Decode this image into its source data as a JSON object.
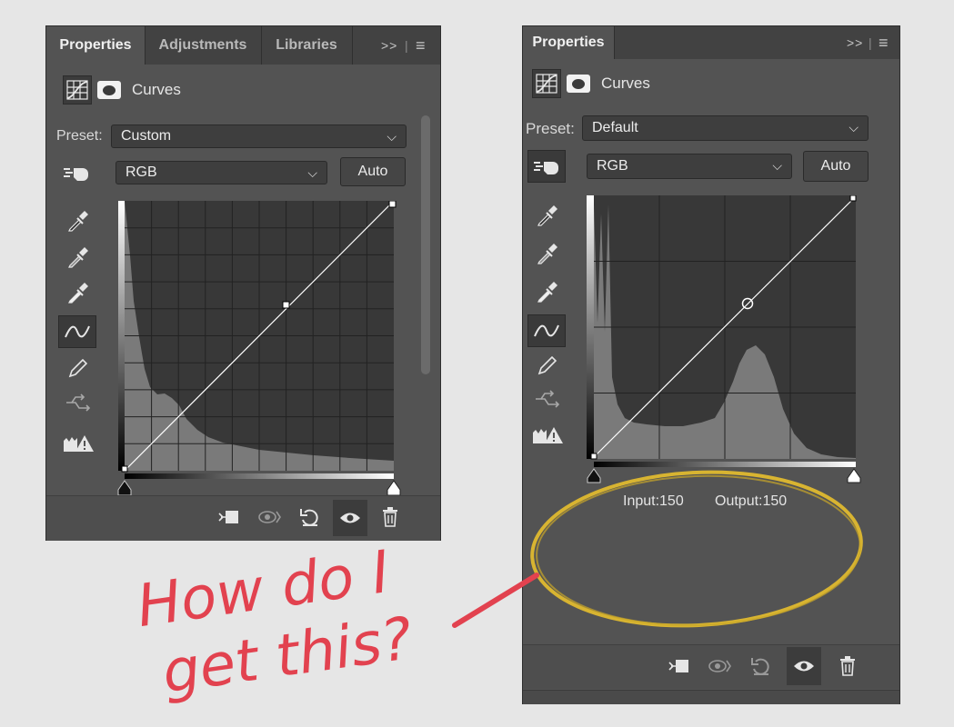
{
  "colors": {
    "panel": "#535353",
    "tabbar": "#424242",
    "accent_circle": "#d8b431",
    "annotation": "#e2424f"
  },
  "left_panel": {
    "tabs": [
      {
        "label": "Properties"
      },
      {
        "label": "Adjustments"
      },
      {
        "label": "Libraries"
      }
    ],
    "menu": {
      "expand": ">>",
      "menu": "≡"
    },
    "header": {
      "title": "Curves",
      "icons": [
        "curves-adjustment-icon",
        "mask-icon"
      ]
    },
    "preset": {
      "label": "Preset:",
      "value": "Custom"
    },
    "channel": {
      "value": "RGB"
    },
    "auto_label": "Auto"
  },
  "right_panel": {
    "tabs": [
      {
        "label": "Properties"
      }
    ],
    "menu": {
      "expand": ">>",
      "menu": "≡"
    },
    "header": {
      "title": "Curves"
    },
    "preset": {
      "label": "Preset:",
      "value": "Default"
    },
    "channel": {
      "value": "RGB"
    },
    "auto_label": "Auto",
    "input_label": "Input:",
    "input_value": "150",
    "output_label": "Output:",
    "output_value": "150"
  },
  "annotation": {
    "line1": "How do I",
    "line2": "get this?"
  }
}
